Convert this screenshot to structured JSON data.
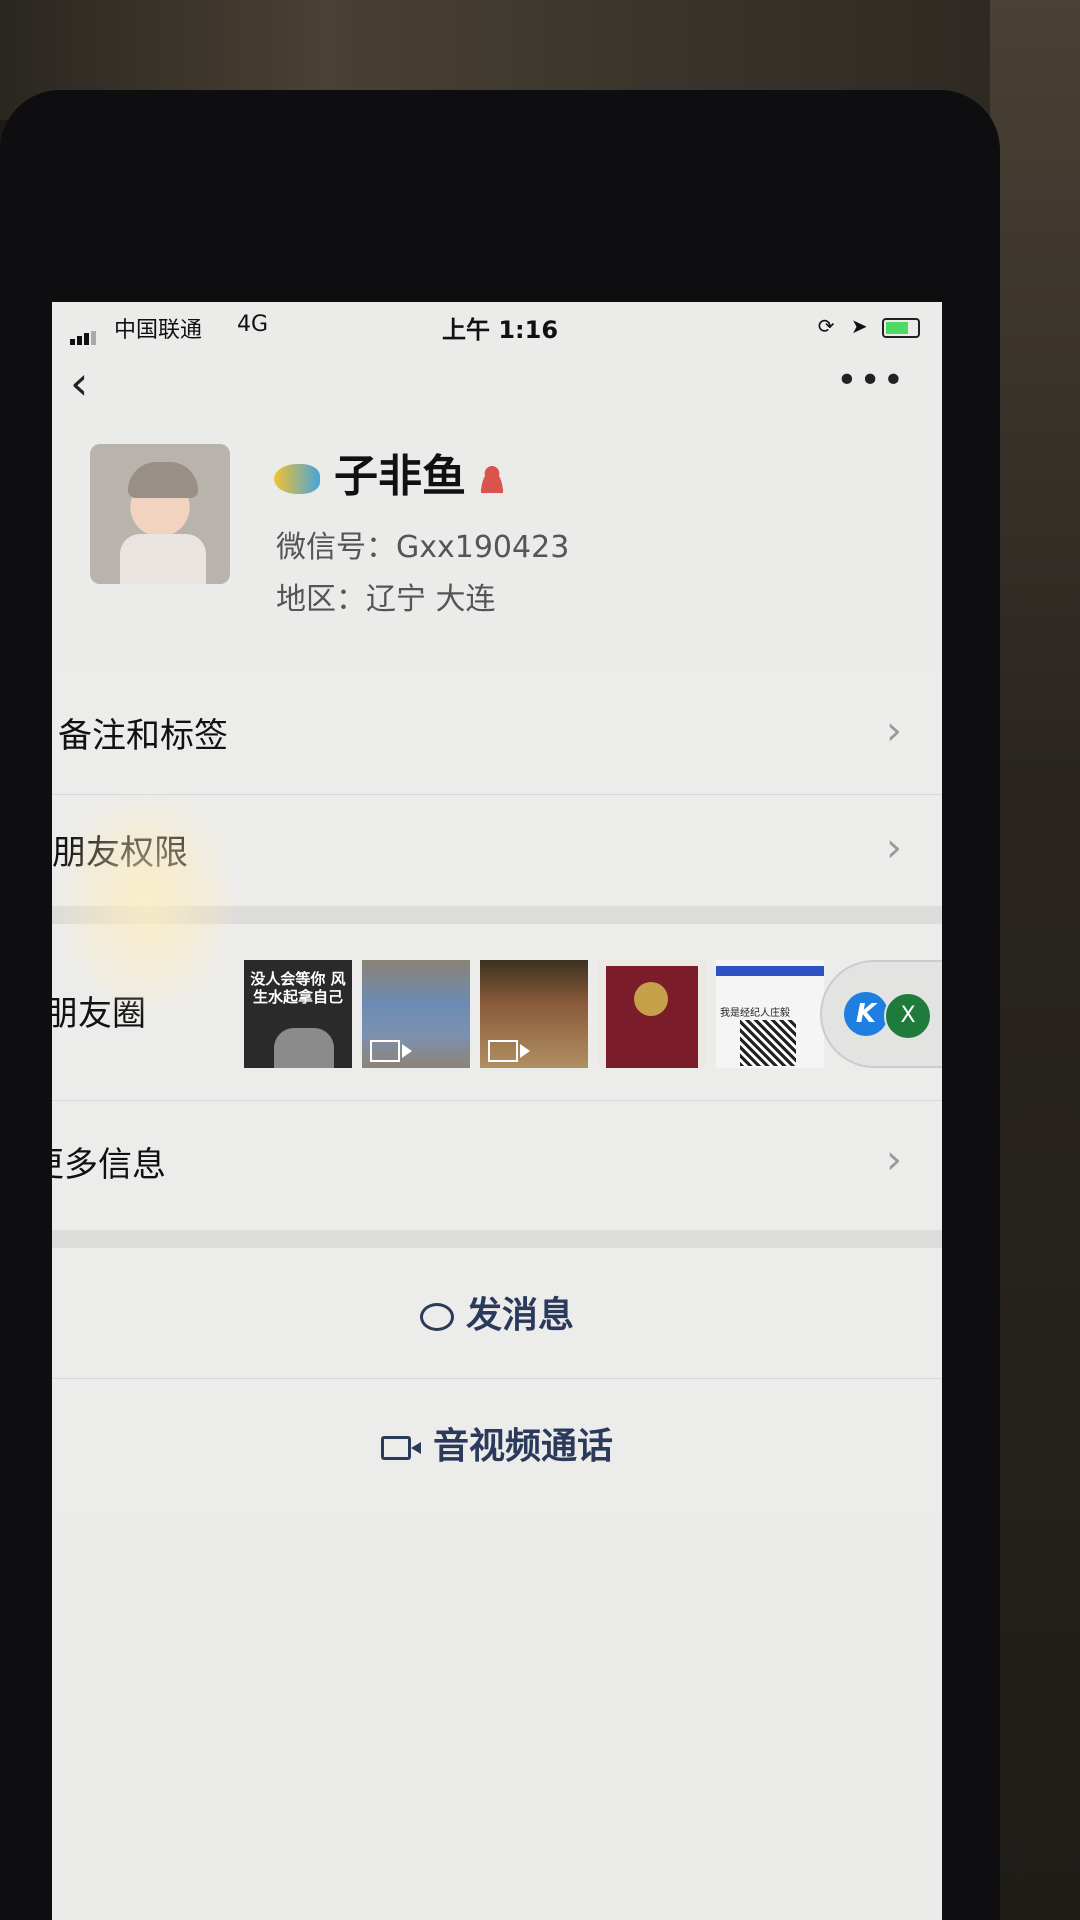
{
  "status_bar": {
    "carrier": "中国联通",
    "network": "4G",
    "time": "上午 1:16"
  },
  "nav": {
    "back_icon": "chevron-left-icon",
    "more_icon": "more-dots-icon",
    "more_label": "•••"
  },
  "profile": {
    "name": "子非鱼",
    "wechat_id": "微信号：Gxx190423",
    "region": "地区：辽宁 大连"
  },
  "rows": {
    "remark_tags": "备注和标签",
    "friend_permissions": "朋友权限",
    "moments": "朋友圈",
    "more_info": "更多信息",
    "chevron": "›"
  },
  "moments_thumbs": {
    "t1_text": "没人会等你 风生水起拿自己",
    "t5_caption": "我是经纪人庄毅"
  },
  "overflow": {
    "k_label": "K",
    "x_label": "X"
  },
  "actions": {
    "send_message": "发消息",
    "video_call": "音视频通话"
  },
  "colors": {
    "accent": "#2b3a5b",
    "screen_bg": "#ebebea"
  }
}
